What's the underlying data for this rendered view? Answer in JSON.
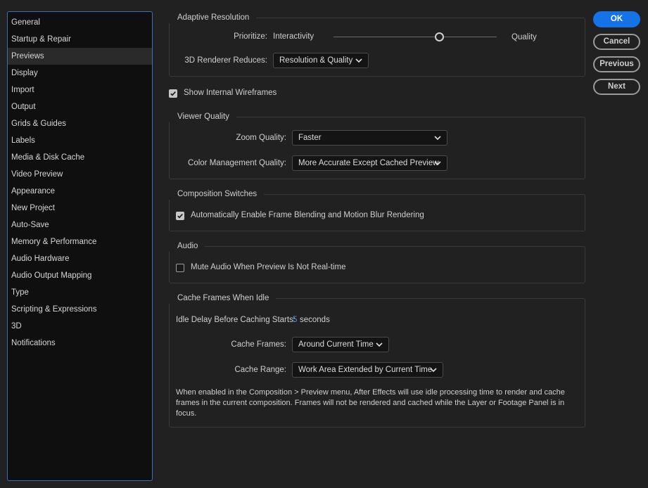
{
  "sidebar": {
    "items": [
      {
        "label": "General"
      },
      {
        "label": "Startup & Repair"
      },
      {
        "label": "Previews",
        "selected": true
      },
      {
        "label": "Display"
      },
      {
        "label": "Import"
      },
      {
        "label": "Output"
      },
      {
        "label": "Grids & Guides"
      },
      {
        "label": "Labels"
      },
      {
        "label": "Media & Disk Cache"
      },
      {
        "label": "Video Preview"
      },
      {
        "label": "Appearance"
      },
      {
        "label": "New Project"
      },
      {
        "label": "Auto-Save"
      },
      {
        "label": "Memory & Performance"
      },
      {
        "label": "Audio Hardware"
      },
      {
        "label": "Audio Output Mapping"
      },
      {
        "label": "Type"
      },
      {
        "label": "Scripting & Expressions"
      },
      {
        "label": "3D"
      },
      {
        "label": "Notifications"
      }
    ]
  },
  "adaptive_resolution": {
    "title": "Adaptive Resolution",
    "prioritize_label": "Prioritize:",
    "slider_min_label": "Interactivity",
    "slider_max_label": "Quality",
    "slider_value": 0.65,
    "renderer_label": "3D Renderer Reduces:",
    "renderer_value": "Resolution & Quality"
  },
  "show_wireframes": {
    "label": "Show Internal Wireframes",
    "checked": true
  },
  "viewer_quality": {
    "title": "Viewer Quality",
    "zoom_label": "Zoom Quality:",
    "zoom_value": "Faster",
    "color_label": "Color Management Quality:",
    "color_value": "More Accurate Except Cached Preview"
  },
  "composition_switches": {
    "title": "Composition Switches",
    "frame_blending_label": "Automatically Enable Frame Blending and Motion Blur Rendering",
    "frame_blending_checked": true
  },
  "audio": {
    "title": "Audio",
    "mute_label": "Mute Audio When Preview Is Not Real-time",
    "mute_checked": false
  },
  "cache_frames": {
    "title": "Cache Frames When Idle",
    "idle_delay_label": "Idle Delay Before Caching Starts:",
    "idle_delay_value": "5",
    "idle_delay_unit": "seconds",
    "cache_frames_label": "Cache Frames:",
    "cache_frames_value": "Around Current Time",
    "cache_range_label": "Cache Range:",
    "cache_range_value": "Work Area Extended by Current Time",
    "description": "When enabled in the Composition > Preview menu, After Effects will use idle processing time to render and cache frames in the current composition. Frames will not be rendered and cached while the Layer or Footage Panel is in focus."
  },
  "buttons": {
    "ok": "OK",
    "cancel": "Cancel",
    "previous": "Previous",
    "next": "Next"
  },
  "colors": {
    "accent": "#1473e6",
    "background": "#212121",
    "sidebar_background": "#0f0f0f",
    "sidebar_border": "#3f6fb3",
    "value_blue": "#4c8fe0"
  },
  "icons": {
    "dropdown": "chevron-down-icon",
    "checkbox": "checkmark-icon"
  }
}
